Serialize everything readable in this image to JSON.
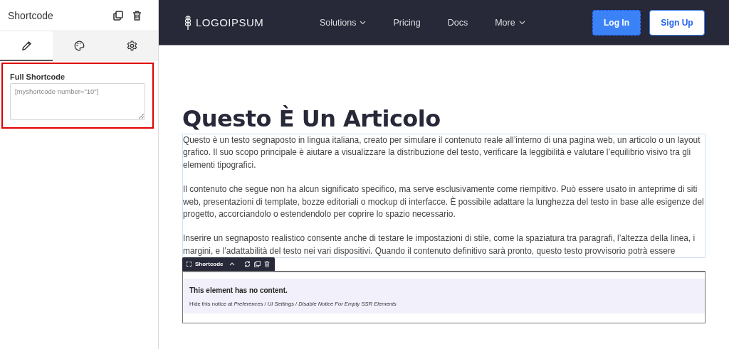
{
  "sidebar": {
    "title": "Shortcode",
    "tabs": [
      {
        "kind": "pencil",
        "selected": true
      },
      {
        "kind": "palette",
        "selected": false
      },
      {
        "kind": "gear",
        "selected": false
      }
    ],
    "field": {
      "label": "Full Shortcode",
      "value": "[myshortcode number=\"10\"]",
      "highlighted": true
    }
  },
  "navbar": {
    "logo": "LOGOIPSUM",
    "links": [
      {
        "label": "Solutions",
        "dropdown": true
      },
      {
        "label": "Pricing",
        "dropdown": false
      },
      {
        "label": "Docs",
        "dropdown": false
      },
      {
        "label": "More",
        "dropdown": true
      }
    ],
    "login": "Log In",
    "signup": "Sign Up"
  },
  "article": {
    "title": "Questo È Un Articolo",
    "paragraphs": [
      "Questo è un testo segnaposto in lingua italiana, creato per simulare il contenuto reale all’interno di una pagina web, un articolo o un layout grafico. Il suo scopo principale è aiutare a visualizzare la distribuzione del testo, verificare la leggibilità e valutare l’equilibrio visivo tra gli elementi tipografici.",
      "Il contenuto che segue non ha alcun significato specifico, ma serve esclusivamente come riempitivo. Può essere usato in anteprime di siti web, presentazioni di template, bozze editoriali o mockup di interfacce. È possibile adattare la lunghezza del testo in base alle esigenze del progetto, accorciandolo o estendendolo per coprire lo spazio necessario.",
      "Inserire un segnaposto realistico consente anche di testare le impostazioni di stile, come la spaziatura tra paragrafi, l’altezza della linea, i margini, e l’adattabilità del testo nei vari dispositivi. Quando il contenuto definitivo sarà pronto, questo testo provvisorio potrà essere"
    ]
  },
  "element": {
    "toolbar_label": "Shortcode",
    "notice_title": "This element has no content.",
    "notice_hint": "Hide this notice at *Preferences* / *UI Settings* / *Disable Notice For Empty SSR Elements*"
  }
}
